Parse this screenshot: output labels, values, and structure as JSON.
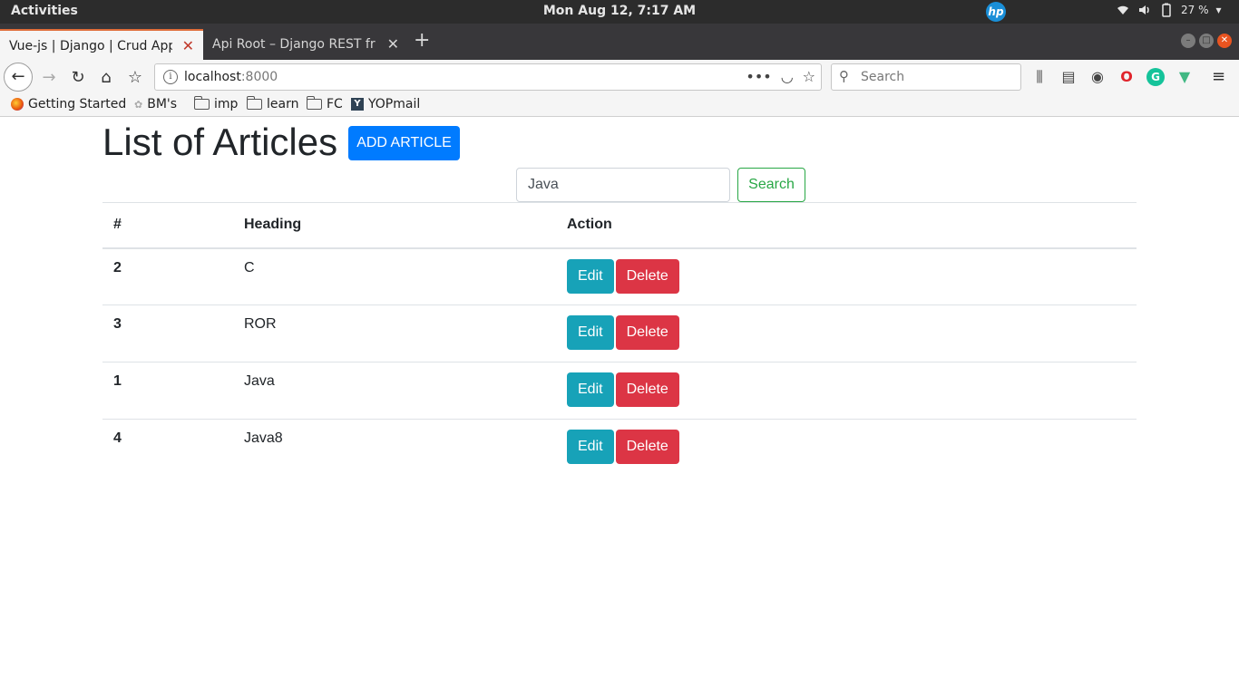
{
  "system_bar": {
    "activities": "Activities",
    "clock": "Mon Aug 12,  7:17 AM",
    "battery": "27 %"
  },
  "browser": {
    "tabs": [
      {
        "title": "Vue-js | Django | Crud App",
        "active": true
      },
      {
        "title": "Api Root – Django REST fram",
        "active": false
      }
    ],
    "url_host": "localhost",
    "url_port": ":8000",
    "search_placeholder": "Search",
    "bookmarks": [
      "Getting Started",
      "BM's",
      "imp",
      "learn",
      "FC",
      "YOPmail"
    ]
  },
  "page": {
    "title": "List of Articles",
    "add_button": "ADD ARTICLE",
    "search_value": "Java",
    "search_button": "Search",
    "columns": [
      "#",
      "Heading",
      "Action"
    ],
    "rows": [
      {
        "id": "2",
        "heading": "C"
      },
      {
        "id": "3",
        "heading": "ROR"
      },
      {
        "id": "1",
        "heading": "Java"
      },
      {
        "id": "4",
        "heading": "Java8"
      }
    ],
    "edit_label": "Edit",
    "delete_label": "Delete"
  },
  "colors": {
    "primary": "#007bff",
    "success": "#28a745",
    "info": "#17a2b8",
    "danger": "#dc3545"
  }
}
